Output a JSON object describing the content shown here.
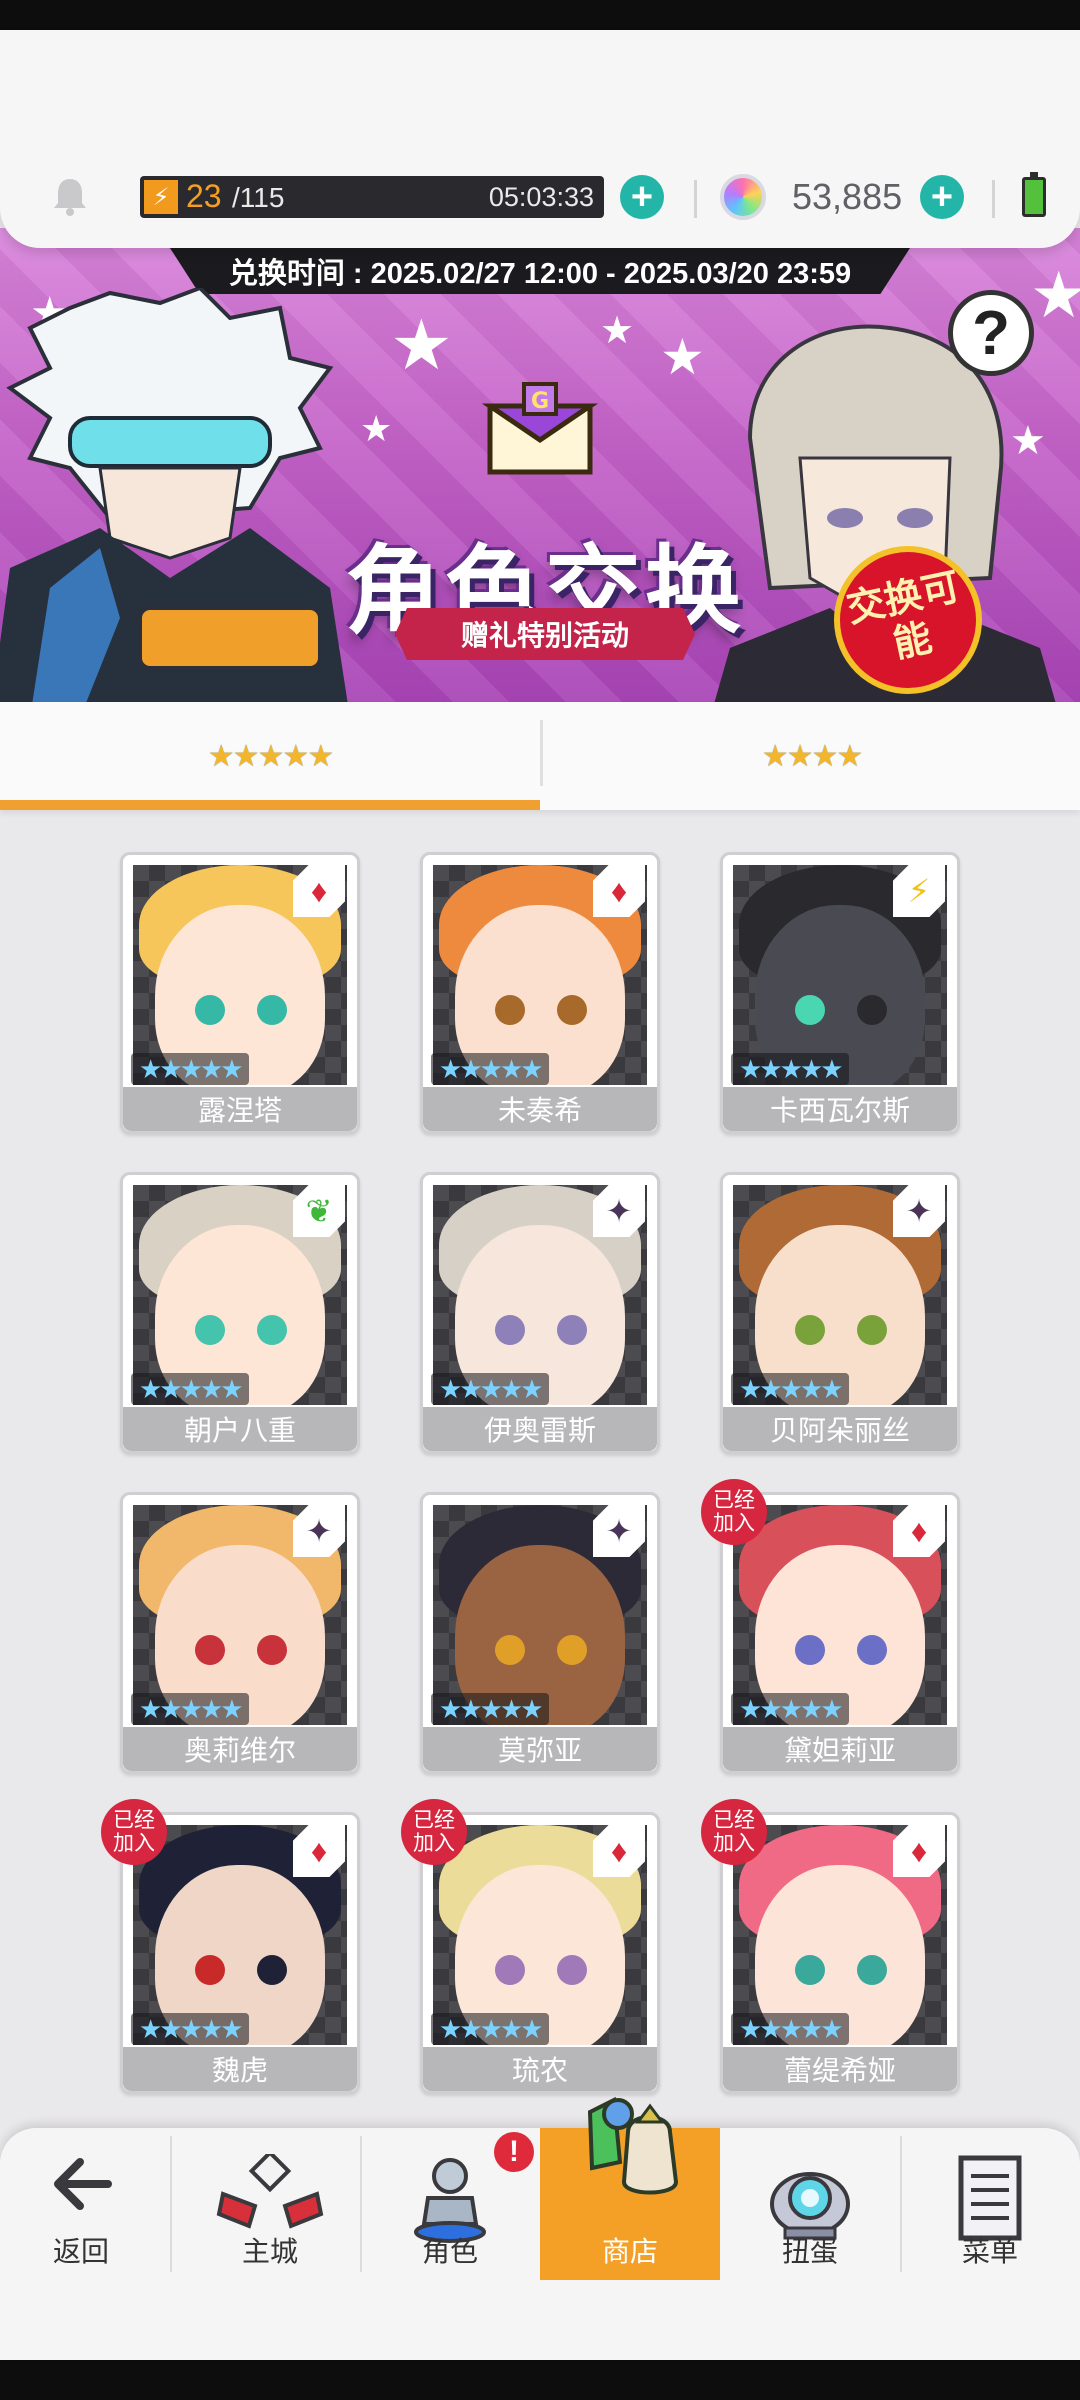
{
  "header": {
    "stamina_current": "23",
    "stamina_max": "/115",
    "stamina_timer": "05:03:33",
    "gems": "53,885",
    "icons": [
      "bell-icon",
      "lightning-icon",
      "plus-icon",
      "gem-icon",
      "battery-icon"
    ]
  },
  "banner": {
    "period": "兑换时间 : 2025.02/27 12:00 - 2025.03/20 23:59",
    "title": "角色交换",
    "subtitle": "赠礼特别活动",
    "badge": "交换可能",
    "help": "?"
  },
  "tabs": [
    {
      "label": "★★★★★",
      "selected": true
    },
    {
      "label": "★★★★",
      "selected": false
    }
  ],
  "characters": [
    {
      "name": "露涅塔",
      "element": "diamond",
      "joined": ""
    },
    {
      "name": "未奏希",
      "element": "diamond",
      "joined": ""
    },
    {
      "name": "卡西瓦尔斯",
      "element": "lightning",
      "joined": ""
    },
    {
      "name": "朝户八重",
      "element": "leaf",
      "joined": ""
    },
    {
      "name": "伊奥雷斯",
      "element": "star",
      "joined": ""
    },
    {
      "name": "贝阿朵丽丝",
      "element": "star",
      "joined": ""
    },
    {
      "name": "奥莉维尔",
      "element": "star",
      "joined": ""
    },
    {
      "name": "莫弥亚",
      "element": "star",
      "joined": ""
    },
    {
      "name": "黛妲莉亚",
      "element": "diamond",
      "joined": "已经加入"
    },
    {
      "name": "魏虎",
      "element": "diamond",
      "joined": "已经加入"
    },
    {
      "name": "琉农",
      "element": "diamond",
      "joined": "已经加入"
    },
    {
      "name": "蕾缇希娅",
      "element": "diamond",
      "joined": "已经加入"
    }
  ],
  "rarity_label": "★★★★★",
  "nav": {
    "back": "返回",
    "city": "主城",
    "character": "角色",
    "shop": "商店",
    "gacha": "扭蛋",
    "menu": "菜单",
    "character_alert": "!"
  },
  "colors": {
    "accent": "#f4a027",
    "teal": "#23b6a8",
    "badge_red": "#d7263f",
    "banner_purple": "#c462c8"
  }
}
